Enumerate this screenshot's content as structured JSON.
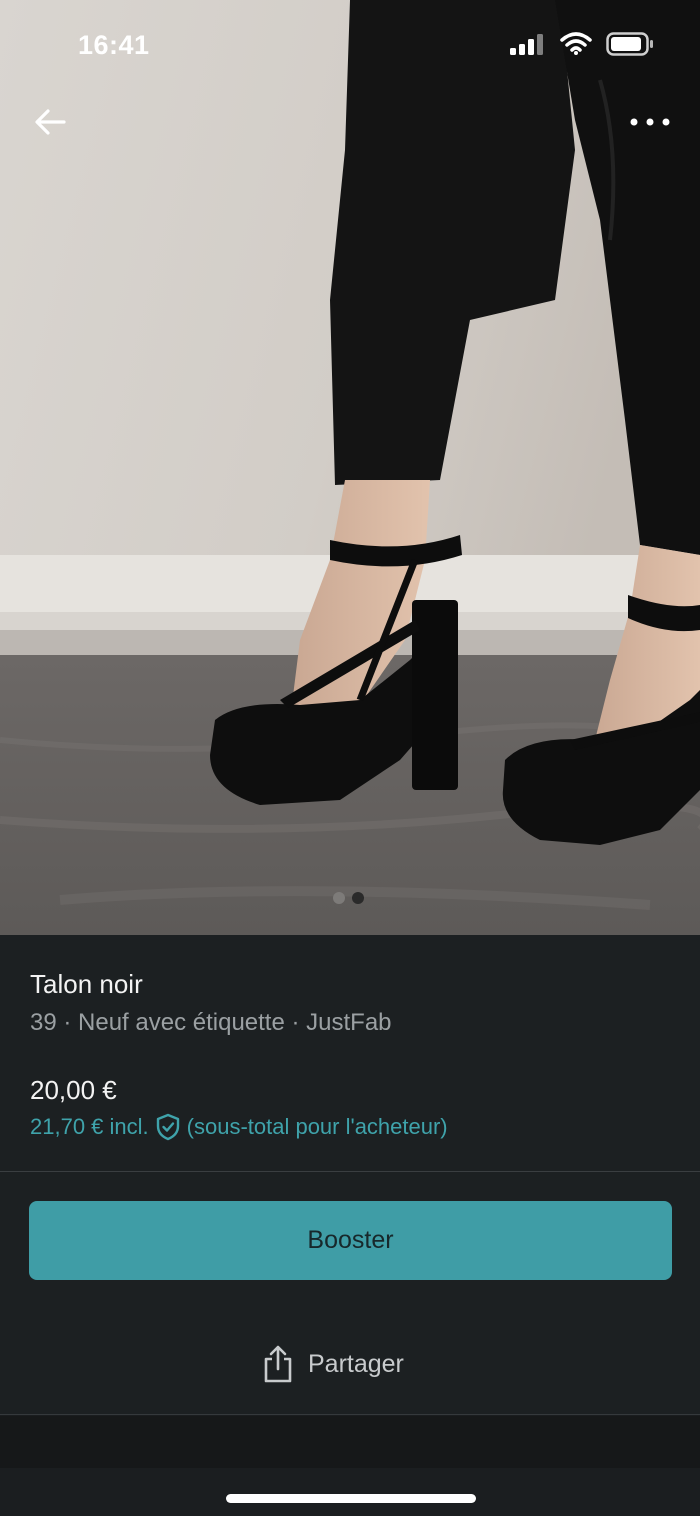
{
  "status_bar": {
    "time": "16:41",
    "signal_icon": "cellular-signal-icon",
    "wifi_icon": "wifi-icon",
    "battery_icon": "battery-icon"
  },
  "nav": {
    "back_icon": "arrow-left-icon",
    "more_icon": "more-horizontal-icon"
  },
  "gallery": {
    "image_description_icon": "product-photo",
    "page_count": 2,
    "active_page": 2
  },
  "item": {
    "title": "Talon noir",
    "subtitle": "39 · Neuf avec étiquette · JustFab",
    "price": "20,00 €",
    "price_incl": "21,70 € incl.",
    "protection_icon": "shield-check-icon",
    "price_incl_note": "(sous-total pour l'acheteur)"
  },
  "actions": {
    "booster_label": "Booster",
    "share_label": "Partager",
    "share_icon": "share-icon"
  },
  "colors": {
    "accent": "#3f9da6",
    "accent_text": "#3fa3ab",
    "panel_bg": "#1c2022"
  }
}
